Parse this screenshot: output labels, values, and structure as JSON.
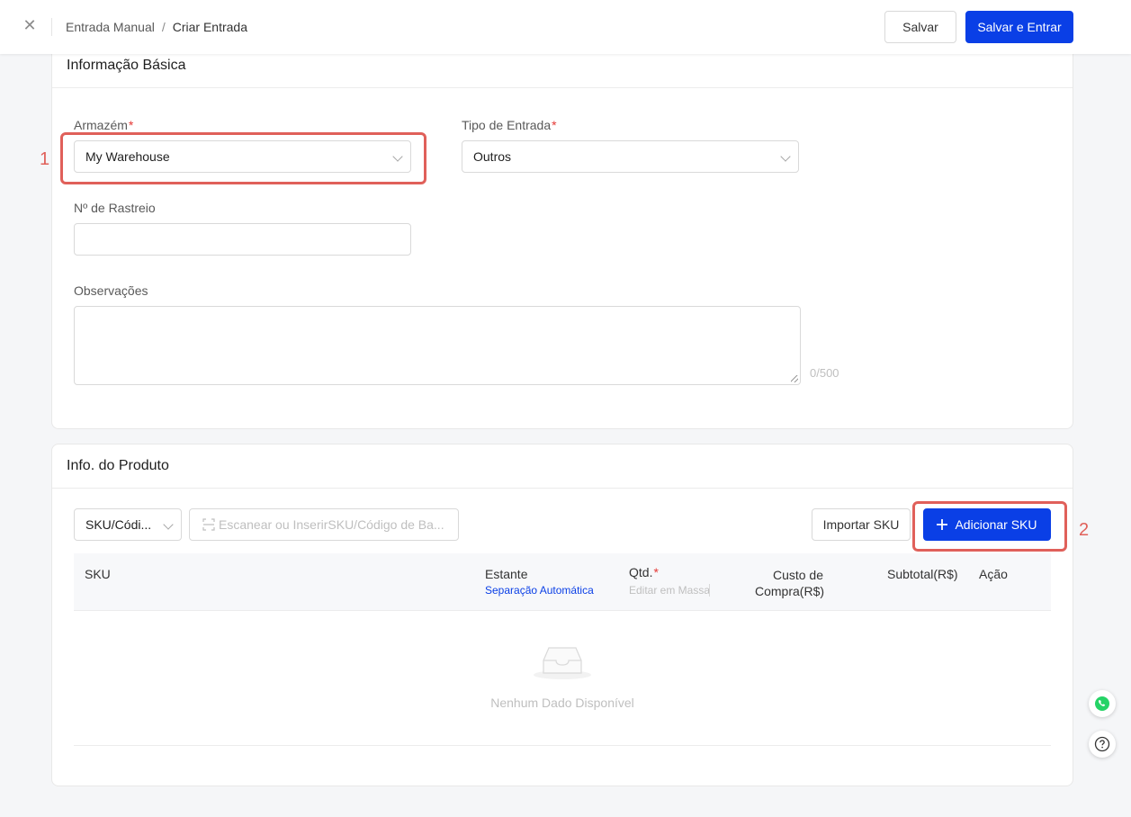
{
  "header": {
    "breadcrumb_parent": "Entrada Manual",
    "breadcrumb_sep": "/",
    "breadcrumb_current": "Criar Entrada",
    "save_label": "Salvar",
    "save_enter_label": "Salvar e Entrar"
  },
  "basic_info": {
    "title": "Informação Básica",
    "warehouse_label": "Armazém",
    "warehouse_value": "My Warehouse",
    "entry_type_label": "Tipo de Entrada",
    "entry_type_value": "Outros",
    "tracking_label": "Nº de Rastreio",
    "tracking_value": "",
    "notes_label": "Observações",
    "notes_counter": "0/500",
    "required_mark": "*"
  },
  "product_info": {
    "title": "Info. do Produto",
    "search_type_value": "SKU/Códi...",
    "search_placeholder": "Escanear ou InserirSKU/Código de Ba...",
    "import_label": "Importar SKU",
    "add_label": "Adicionar SKU",
    "columns": {
      "sku": "SKU",
      "shelf": "Estante",
      "shelf_sub": "Separação Automática",
      "qty": "Qtd.",
      "qty_sub": "Editar em Massa",
      "cost_line1": "Custo de",
      "cost_line2": "Compra(R$)",
      "subtotal": "Subtotal(R$)",
      "action": "Ação"
    },
    "empty_text": "Nenhum Dado Disponível"
  },
  "annotations": {
    "one": "1",
    "two": "2"
  },
  "colors": {
    "primary": "#0a3fe6",
    "annotation": "#e0605a",
    "required": "#e53935",
    "whatsapp": "#25d366"
  },
  "icons": {
    "close": "close-icon",
    "scan": "scan-icon",
    "plus": "plus-icon",
    "empty": "empty-inbox-icon",
    "whatsapp": "whatsapp-icon",
    "help": "help-icon"
  }
}
